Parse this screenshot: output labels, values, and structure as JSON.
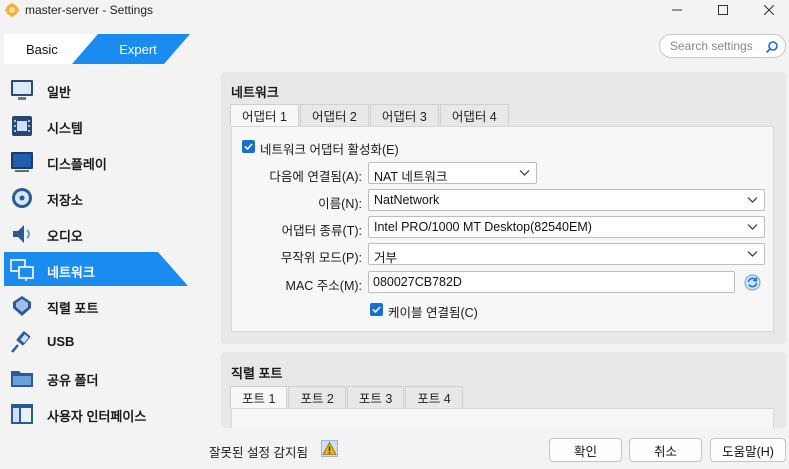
{
  "window": {
    "title": "master-server - Settings"
  },
  "mode": {
    "basic": "Basic",
    "expert": "Expert"
  },
  "search": {
    "placeholder": "Search settings"
  },
  "sidebar": {
    "items": [
      {
        "label": "일반",
        "icon": "general-monitor-icon"
      },
      {
        "label": "시스템",
        "icon": "system-chip-icon"
      },
      {
        "label": "디스플레이",
        "icon": "display-monitor-icon"
      },
      {
        "label": "저장소",
        "icon": "storage-disk-icon"
      },
      {
        "label": "오디오",
        "icon": "audio-speaker-icon"
      },
      {
        "label": "네트워크",
        "icon": "network-icon"
      },
      {
        "label": "직렬 포트",
        "icon": "serial-port-icon"
      },
      {
        "label": "USB",
        "icon": "usb-plug-icon"
      },
      {
        "label": "공유 폴더",
        "icon": "shared-folder-icon"
      },
      {
        "label": "사용자 인터페이스",
        "icon": "user-interface-icon"
      }
    ],
    "active_index": 5
  },
  "network": {
    "title": "네트워크",
    "tabs": [
      "어댑터 1",
      "어댑터 2",
      "어댑터 3",
      "어댑터 4"
    ],
    "enable_label": "네트워크 어댑터 활성화(E)",
    "attached_label": "다음에 연결됨(A):",
    "attached_value": "NAT 네트워크",
    "name_label": "이름(N):",
    "name_value": "NatNetwork",
    "adapter_type_label": "어댑터 종류(T):",
    "adapter_type_value": "Intel PRO/1000 MT Desktop(82540EM)",
    "promiscuous_label": "무작위 모드(P):",
    "promiscuous_value": "거부",
    "mac_label": "MAC 주소(M):",
    "mac_value": "080027CB782D",
    "cable_label": "케이블 연결됨(C)"
  },
  "serial": {
    "title": "직렬 포트",
    "tabs": [
      "포트 1",
      "포트 2",
      "포트 3",
      "포트 4"
    ]
  },
  "footer": {
    "warning": "잘못된 설정 감지됨",
    "ok": "확인",
    "cancel": "취소",
    "help": "도움말(H)"
  },
  "colors": {
    "accent": "#1a8cf0",
    "checkbox": "#1a6fd1"
  }
}
